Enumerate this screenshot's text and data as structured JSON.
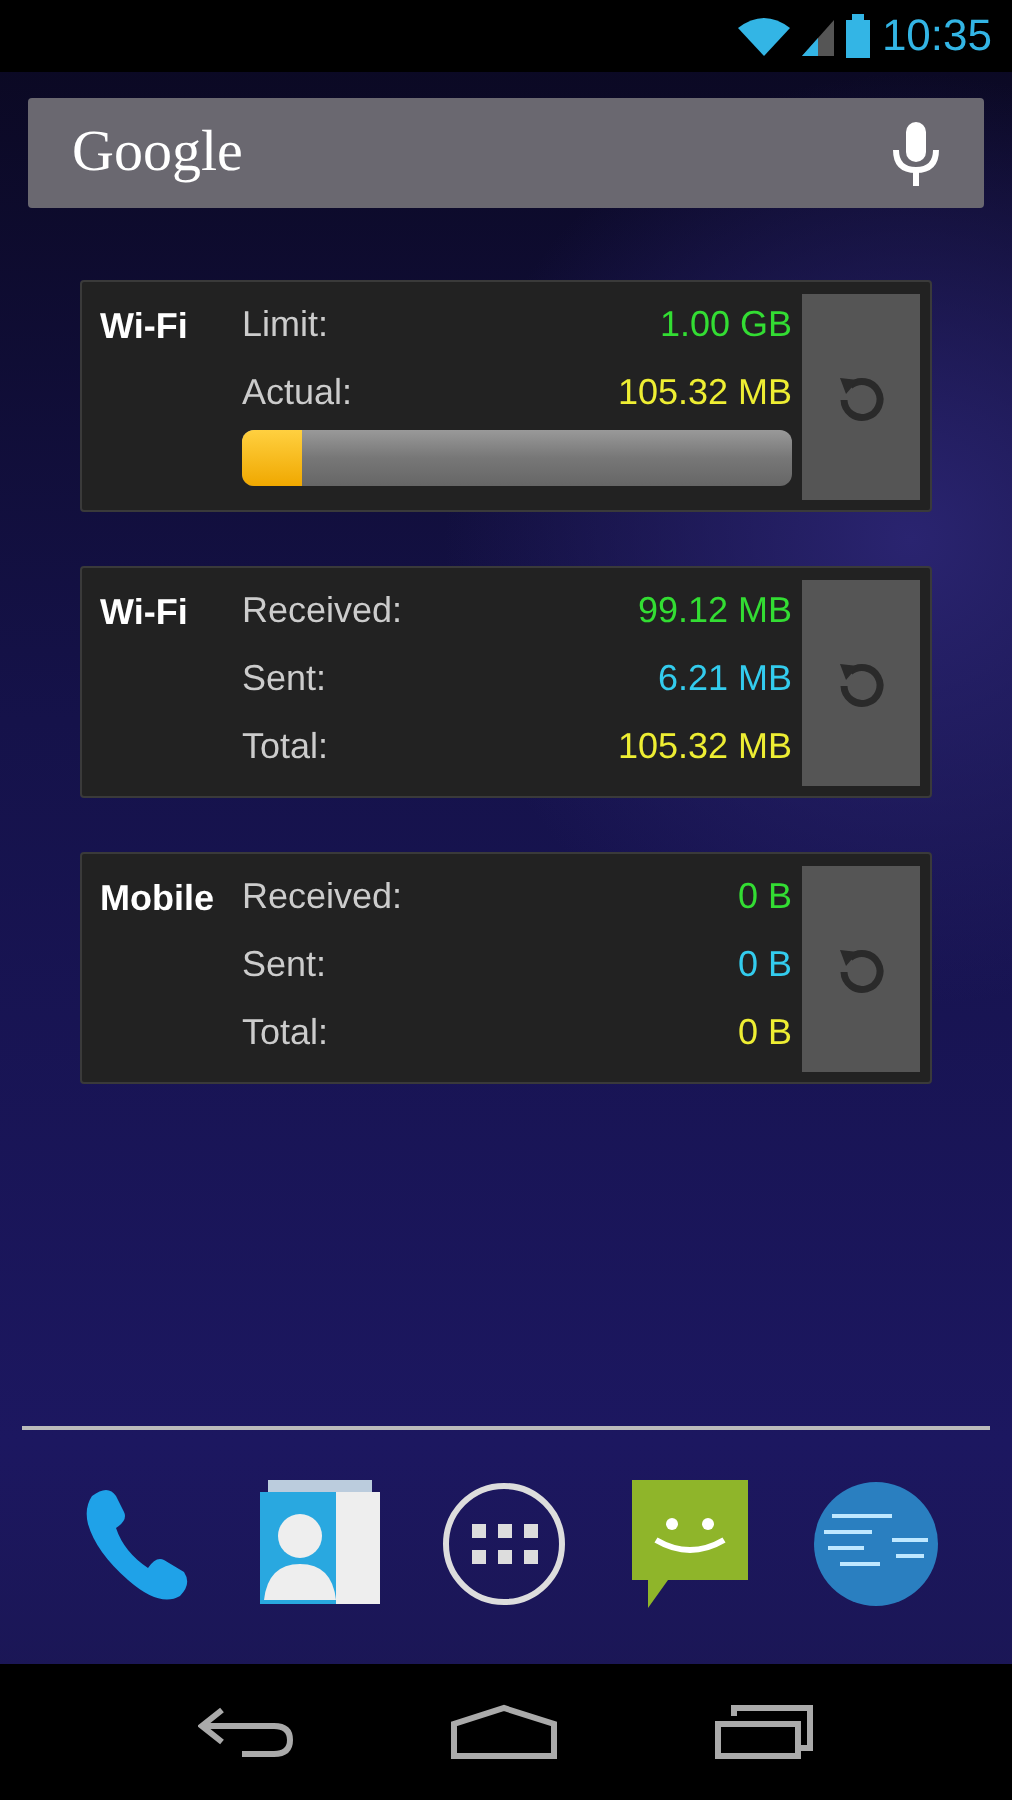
{
  "status_bar": {
    "time": "10:35"
  },
  "search": {
    "logo": "Google"
  },
  "widgets": [
    {
      "kind": "limit",
      "title": "Wi-Fi",
      "level": 0.11,
      "rows": [
        {
          "label": "Limit:",
          "value": "1.00 GB",
          "color": "#33dd33"
        },
        {
          "label": "Actual:",
          "value": "105.32 MB",
          "color": "#eeee33"
        }
      ]
    },
    {
      "kind": "stats",
      "title": "Wi-Fi",
      "rows": [
        {
          "label": "Received:",
          "value": "99.12 MB",
          "color": "#33dd33"
        },
        {
          "label": "Sent:",
          "value": "6.21 MB",
          "color": "#33ccee"
        },
        {
          "label": "Total:",
          "value": "105.32 MB",
          "color": "#eeee33"
        }
      ]
    },
    {
      "kind": "stats",
      "title": "Mobile",
      "rows": [
        {
          "label": "Received:",
          "value": "0 B",
          "color": "#33dd33"
        },
        {
          "label": "Sent:",
          "value": "0 B",
          "color": "#33ccee"
        },
        {
          "label": "Total:",
          "value": "0 B",
          "color": "#eeee33"
        }
      ]
    }
  ]
}
